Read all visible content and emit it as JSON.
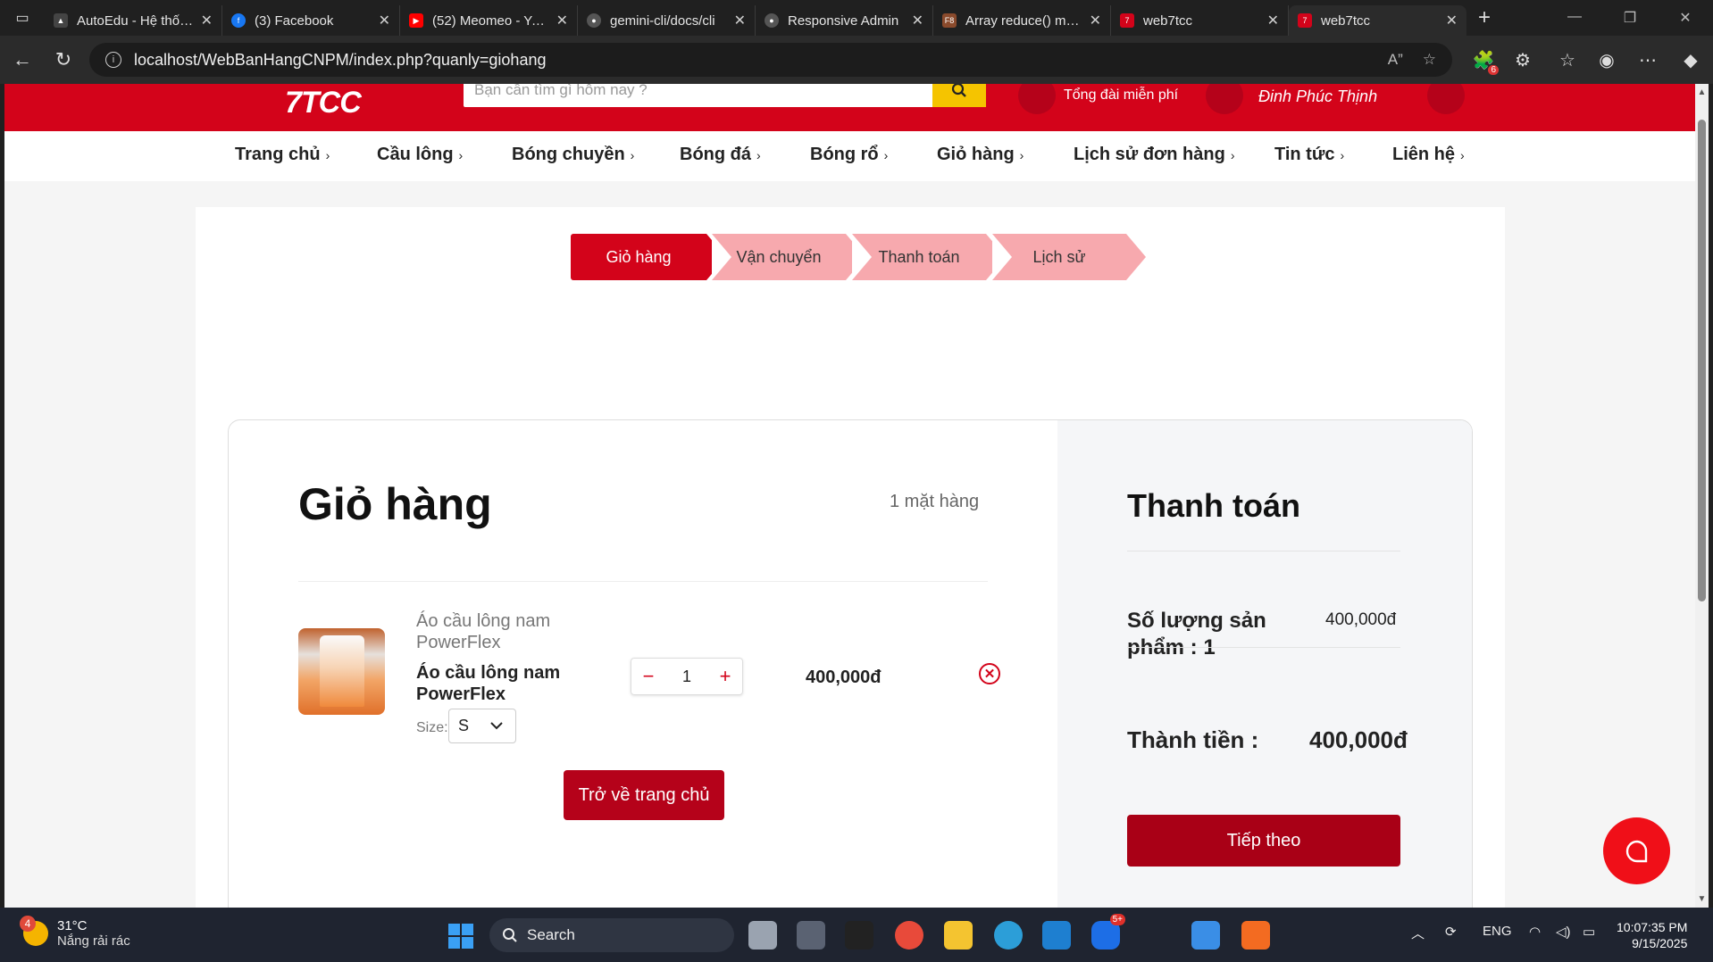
{
  "browser": {
    "tabs": [
      {
        "title": "AutoEdu - Hệ thống",
        "favicon_color": "#444444"
      },
      {
        "title": "(3) Facebook",
        "favicon_color": "#1877f2"
      },
      {
        "title": "(52) Meomeo - YouTube",
        "favicon_color": "#ff0000"
      },
      {
        "title": "gemini-cli/docs/cli",
        "favicon_color": "#555555"
      },
      {
        "title": "Responsive Admin",
        "favicon_color": "#555555"
      },
      {
        "title": "Array reduce() method",
        "favicon_color": "#8a4a2c"
      },
      {
        "title": "web7tcc",
        "favicon_color": "#d3031a"
      },
      {
        "title": "web7tcc",
        "favicon_color": "#d3031a"
      }
    ],
    "url": "localhost/WebBanHangCNPM/index.php?quanly=giohang",
    "extension_badge": "6"
  },
  "site": {
    "logo": "7TCC",
    "search_placeholder": "Bạn cần tìm gì hôm nay ?",
    "hotline_label": "Tổng đài miễn phí",
    "user_name": "Đinh Phúc Thịnh",
    "brand_color": "#d3031a",
    "nav": [
      "Trang chủ",
      "Cầu lông",
      "Bóng chuyền",
      "Bóng đá",
      "Bóng rổ",
      "Giỏ hàng",
      "Lịch sử đơn hàng",
      "Tin tức",
      "Liên hệ"
    ]
  },
  "steps": [
    "Giỏ hàng",
    "Vận chuyển",
    "Thanh toán",
    "Lịch sử"
  ],
  "cart": {
    "title": "Giỏ hàng",
    "count": "1 mặt hàng",
    "item": {
      "category": "Áo cầu lông nam PowerFlex",
      "name": "Áo cầu lông nam PowerFlex",
      "size_label": "Size:",
      "size": "S",
      "qty": "1",
      "price": "400,000đ"
    },
    "home_button": "Trở về trang chủ"
  },
  "summary": {
    "title": "Thanh toán",
    "qty_label": "Số lượng sản phẩm : 1",
    "qty_price": "400,000đ",
    "total_label": "Thành tiền :",
    "total": "400,000đ",
    "next_button": "Tiếp theo"
  },
  "taskbar": {
    "temp": "31°C",
    "weather": "Nắng rải rác",
    "weather_badge": "4",
    "search": "Search",
    "zalo_badge": "5+",
    "lang": "ENG",
    "time": "10:07:35 PM",
    "date": "9/15/2025"
  }
}
